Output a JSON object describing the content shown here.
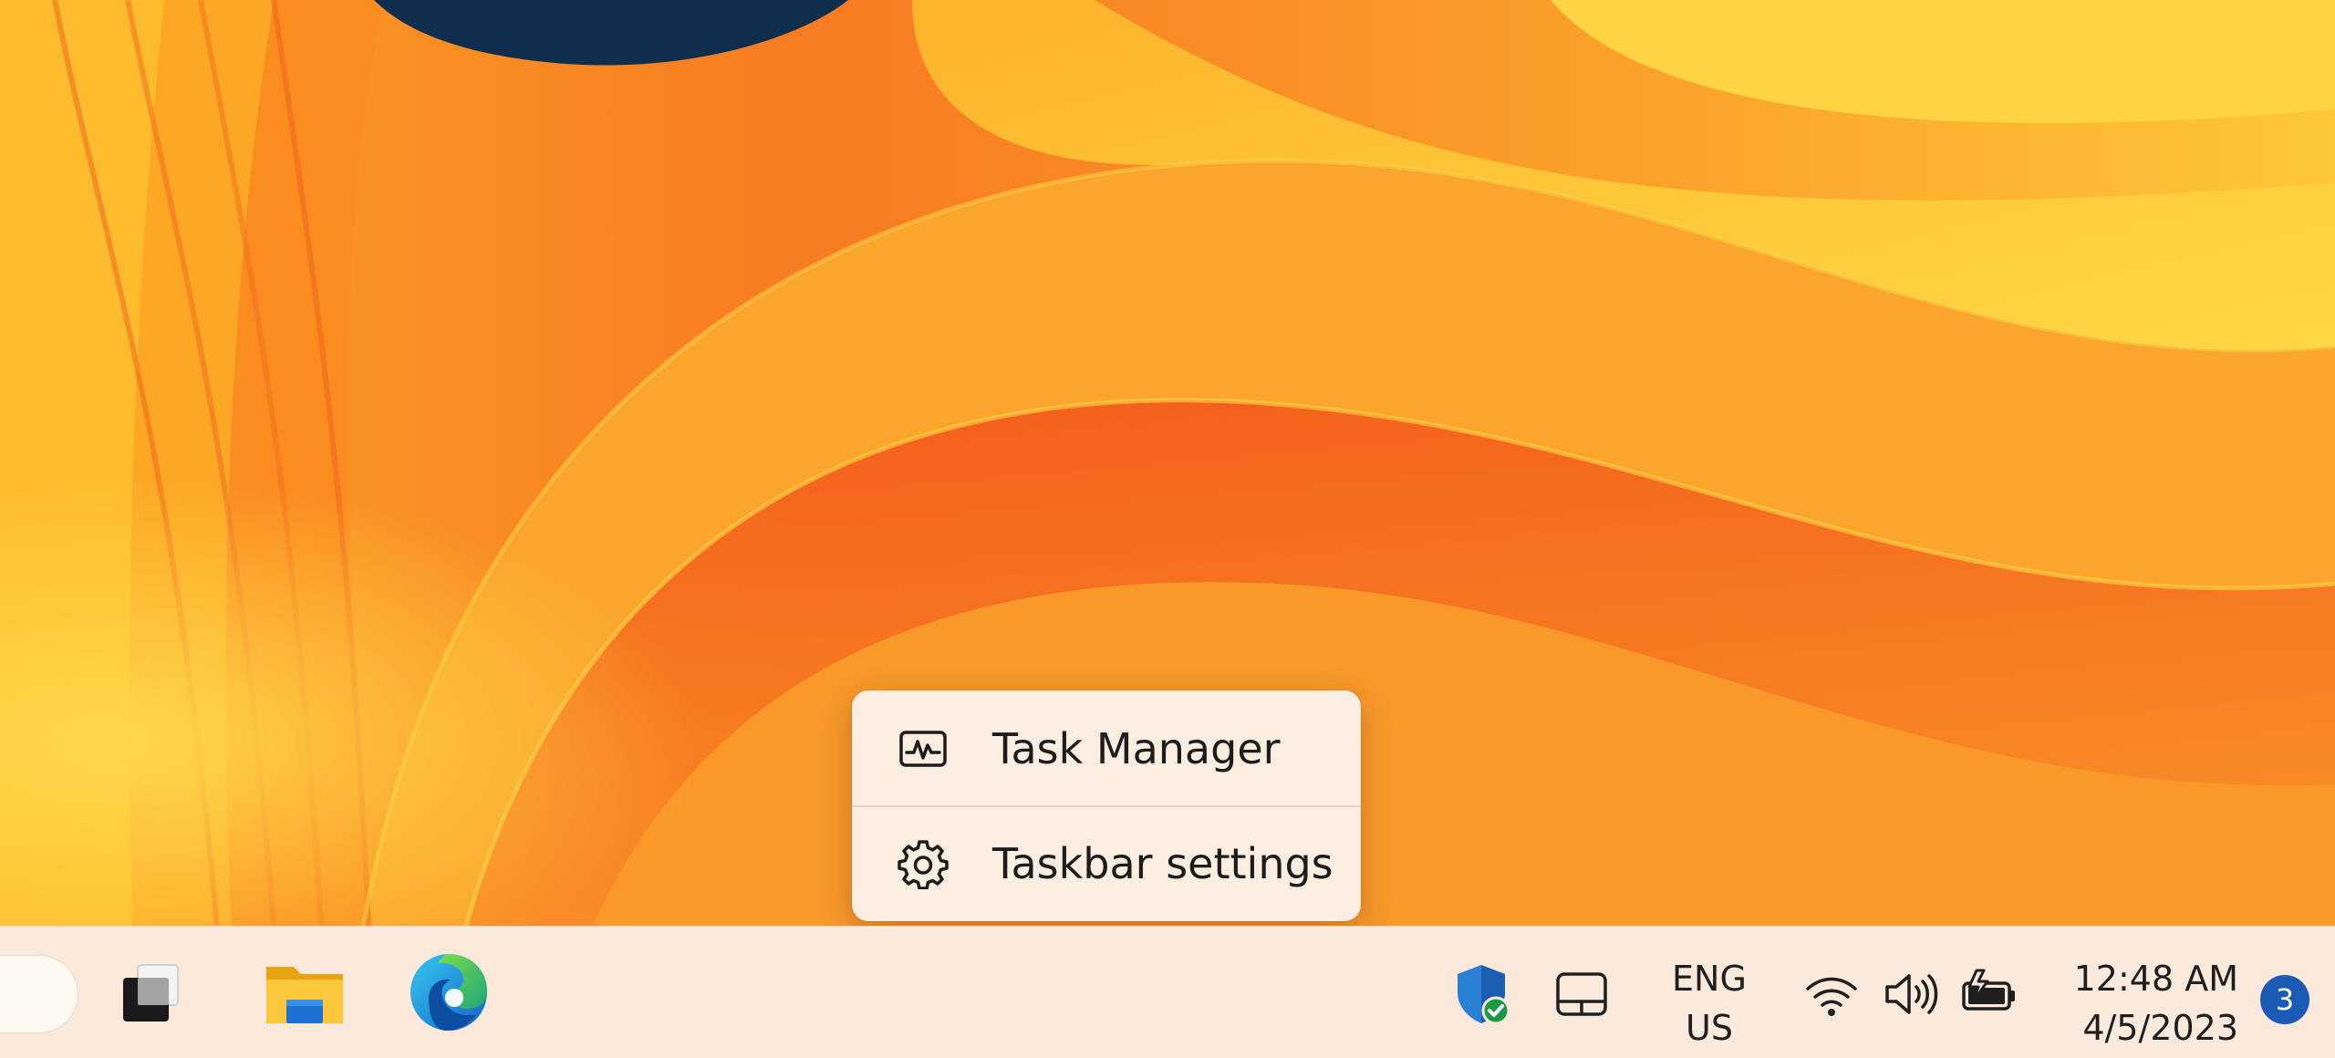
{
  "context_menu": {
    "items": [
      {
        "label": "Task Manager",
        "icon": "task-manager-icon"
      },
      {
        "label": "Taskbar settings",
        "icon": "gear-icon"
      }
    ]
  },
  "taskbar": {
    "pinned_apps": [
      {
        "icon": "task-view-icon",
        "running": false
      },
      {
        "icon": "file-explorer-icon",
        "running": true
      },
      {
        "icon": "edge-icon",
        "running": true
      }
    ],
    "tray": {
      "icons": [
        "windows-security-icon",
        "touchpad-icon",
        "wifi-icon",
        "volume-icon",
        "battery-charging-icon"
      ],
      "language_line1": "ENG",
      "language_line2": "US",
      "time": "12:48 AM",
      "date": "4/5/2023",
      "notification_count": "3"
    }
  },
  "colors": {
    "accent": "#1c5bb5",
    "menu_background": "#fbeee1",
    "taskbar_background": "#fbeadb",
    "wallpaper_orange": "#f57a1d",
    "wallpaper_yellow": "#fcc335"
  }
}
